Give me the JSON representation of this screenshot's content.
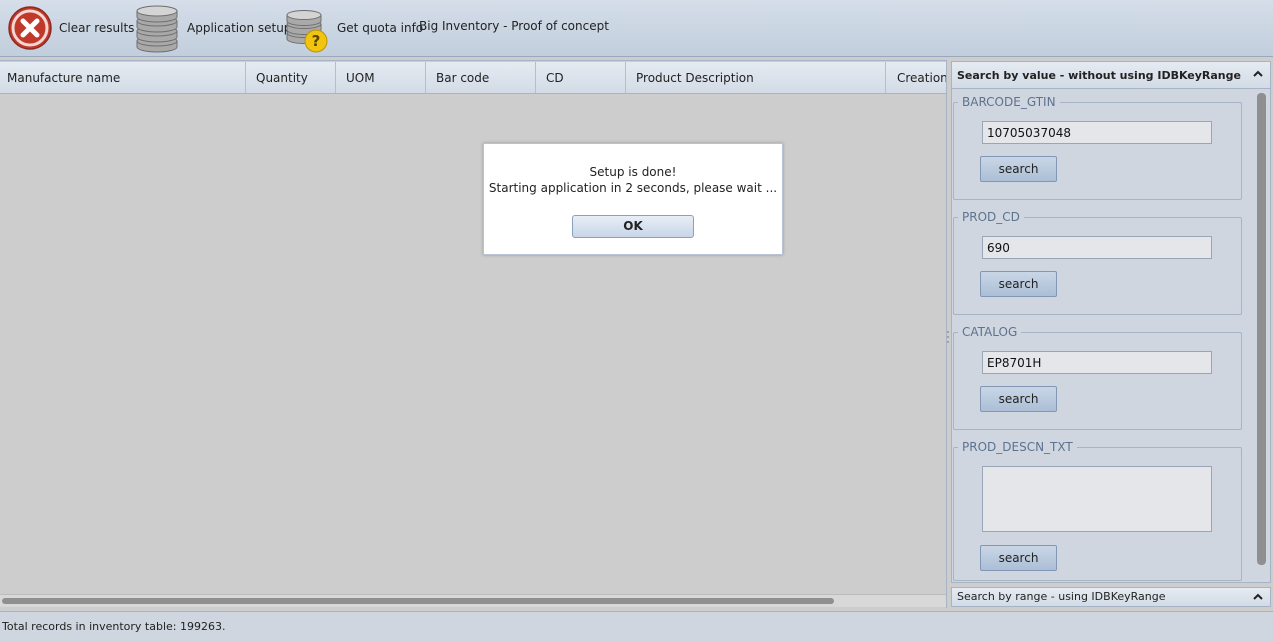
{
  "toolbar": {
    "clear_label": "Clear results",
    "setup_label": "Application setup",
    "quota_label": "Get quota info",
    "app_title": "Big Inventory - Proof of concept"
  },
  "grid": {
    "columns": [
      "Manufacture name",
      "Quantity",
      "UOM",
      "Bar code",
      "CD",
      "Product Description",
      "Creation"
    ]
  },
  "search_panel": {
    "title": "Search by value - without using IDBKeyRange",
    "groups": [
      {
        "legend": "BARCODE_GTIN",
        "value": "10705037048",
        "button": "search"
      },
      {
        "legend": "PROD_CD",
        "value": "690",
        "button": "search"
      },
      {
        "legend": "CATALOG",
        "value": "EP8701H",
        "button": "search"
      },
      {
        "legend": "PROD_DESCN_TXT",
        "value": "",
        "button": "search"
      }
    ],
    "range_title": "Search by range - using IDBKeyRange"
  },
  "status": {
    "text": "Total records in inventory table: 199263."
  },
  "dialog": {
    "line1": "Setup is done!",
    "line2": "Starting application in 2 seconds, please wait ...",
    "ok_label": "OK"
  },
  "colors": {
    "toolbar_bg": "#c8d3e1",
    "accent": "#5d7290",
    "clear_icon_red": "#c0392b",
    "quota_icon_yellow": "#f1c40f"
  },
  "icons": {
    "clear": "close-circle-icon",
    "setup": "database-icon",
    "quota": "database-question-icon",
    "collapse": "chevron-up-icon"
  }
}
